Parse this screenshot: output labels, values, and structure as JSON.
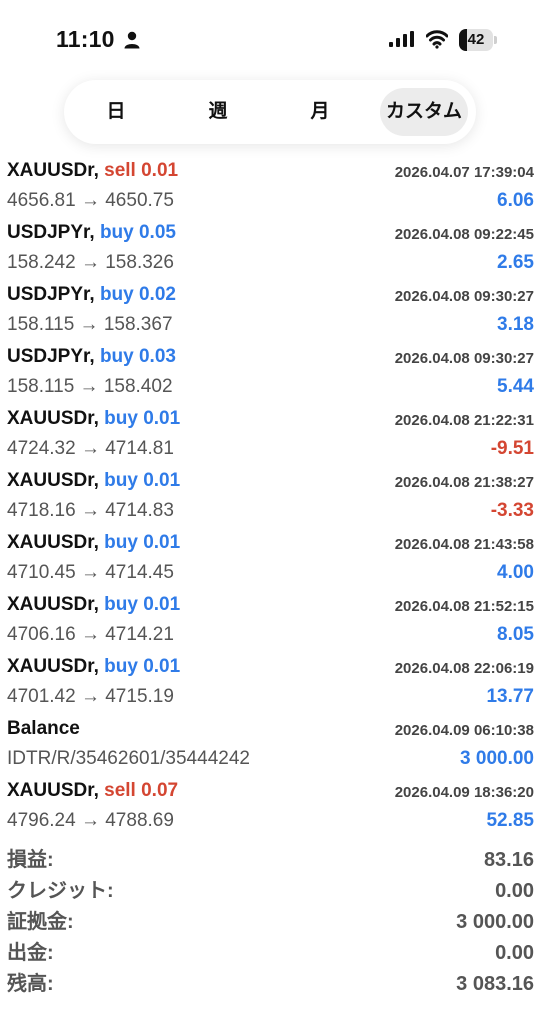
{
  "status_bar": {
    "time": "11:10",
    "battery_level": "42"
  },
  "period_tabs": [
    {
      "label": "日",
      "active": false
    },
    {
      "label": "週",
      "active": false
    },
    {
      "label": "月",
      "active": false
    },
    {
      "label": "カスタム",
      "active": true
    }
  ],
  "trades": [
    {
      "symbol": "XAUUSDr",
      "side": "sell",
      "volume": "0.01",
      "side_volume": "sell 0.01",
      "datetime": "2026.04.07 17:39:04",
      "prices": "4656.81 → 4650.75",
      "profit": "6.06",
      "profit_sign": "positive"
    },
    {
      "symbol": "USDJPYr",
      "side": "buy",
      "volume": "0.05",
      "side_volume": "buy 0.05",
      "datetime": "2026.04.08 09:22:45",
      "prices": "158.242 → 158.326",
      "profit": "2.65",
      "profit_sign": "positive"
    },
    {
      "symbol": "USDJPYr",
      "side": "buy",
      "volume": "0.02",
      "side_volume": "buy 0.02",
      "datetime": "2026.04.08 09:30:27",
      "prices": "158.115 → 158.367",
      "profit": "3.18",
      "profit_sign": "positive"
    },
    {
      "symbol": "USDJPYr",
      "side": "buy",
      "volume": "0.03",
      "side_volume": "buy 0.03",
      "datetime": "2026.04.08 09:30:27",
      "prices": "158.115 → 158.402",
      "profit": "5.44",
      "profit_sign": "positive"
    },
    {
      "symbol": "XAUUSDr",
      "side": "buy",
      "volume": "0.01",
      "side_volume": "buy 0.01",
      "datetime": "2026.04.08 21:22:31",
      "prices": "4724.32 → 4714.81",
      "profit": "-9.51",
      "profit_sign": "negative"
    },
    {
      "symbol": "XAUUSDr",
      "side": "buy",
      "volume": "0.01",
      "side_volume": "buy 0.01",
      "datetime": "2026.04.08 21:38:27",
      "prices": "4718.16 → 4714.83",
      "profit": "-3.33",
      "profit_sign": "negative"
    },
    {
      "symbol": "XAUUSDr",
      "side": "buy",
      "volume": "0.01",
      "side_volume": "buy 0.01",
      "datetime": "2026.04.08 21:43:58",
      "prices": "4710.45 → 4714.45",
      "profit": "4.00",
      "profit_sign": "positive"
    },
    {
      "symbol": "XAUUSDr",
      "side": "buy",
      "volume": "0.01",
      "side_volume": "buy 0.01",
      "datetime": "2026.04.08 21:52:15",
      "prices": "4706.16 → 4714.21",
      "profit": "8.05",
      "profit_sign": "positive"
    },
    {
      "symbol": "XAUUSDr",
      "side": "buy",
      "volume": "0.01",
      "side_volume": "buy 0.01",
      "datetime": "2026.04.08 22:06:19",
      "prices": "4701.42 → 4715.19",
      "profit": "13.77",
      "profit_sign": "positive"
    },
    {
      "symbol": "Balance",
      "side": "",
      "volume": "",
      "side_volume": "",
      "datetime": "2026.04.09 06:10:38",
      "prices": "IDTR/R/35462601/35444242",
      "profit": "3 000.00",
      "profit_sign": "positive"
    },
    {
      "symbol": "XAUUSDr",
      "side": "sell",
      "volume": "0.07",
      "side_volume": "sell 0.07",
      "datetime": "2026.04.09 18:36:20",
      "prices": "4796.24 → 4788.69",
      "profit": "52.85",
      "profit_sign": "positive"
    }
  ],
  "summary": [
    {
      "label": "損益:",
      "value": "83.16"
    },
    {
      "label": "クレジット:",
      "value": "0.00"
    },
    {
      "label": "証拠金:",
      "value": "3 000.00"
    },
    {
      "label": "出金:",
      "value": "0.00"
    },
    {
      "label": "残高:",
      "value": "3 083.16"
    }
  ],
  "colors": {
    "buy": "#2f7be8",
    "sell": "#d44632",
    "profit_positive": "#2f7be8",
    "profit_negative": "#d44632"
  },
  "icons": [
    "person-icon",
    "cellular-signal-icon",
    "wifi-icon",
    "battery-icon"
  ]
}
